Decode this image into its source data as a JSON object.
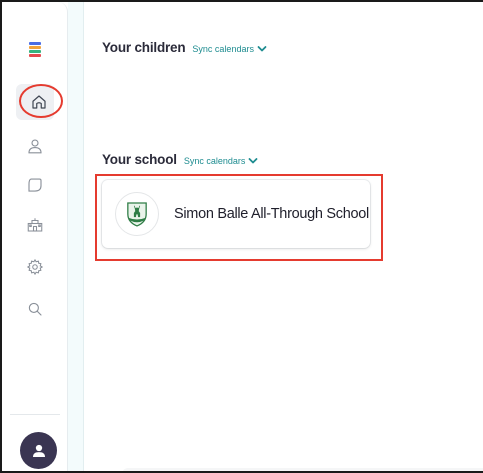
{
  "sidebar": {
    "logo": "app-logo",
    "items": [
      {
        "name": "home",
        "icon": "home-icon",
        "active": true
      },
      {
        "name": "profile",
        "icon": "user-icon"
      },
      {
        "name": "messages",
        "icon": "chat-bubble-icon"
      },
      {
        "name": "school",
        "icon": "school-building-icon"
      },
      {
        "name": "settings",
        "icon": "gear-icon"
      },
      {
        "name": "search",
        "icon": "search-icon"
      }
    ],
    "account": {
      "icon": "person-icon"
    }
  },
  "main": {
    "children_section": {
      "title": "Your children",
      "sync_label": "Sync calendars"
    },
    "school_section": {
      "title": "Your school",
      "sync_label": "Sync calendars",
      "school": {
        "name": "Simon Balle All-Through School",
        "crest": "school-crest-icon"
      }
    }
  },
  "colors": {
    "accent": "#1e8c90",
    "annotation": "#e53b2f",
    "avatar_bg": "#3a3552",
    "text": "#2b2b3a"
  }
}
